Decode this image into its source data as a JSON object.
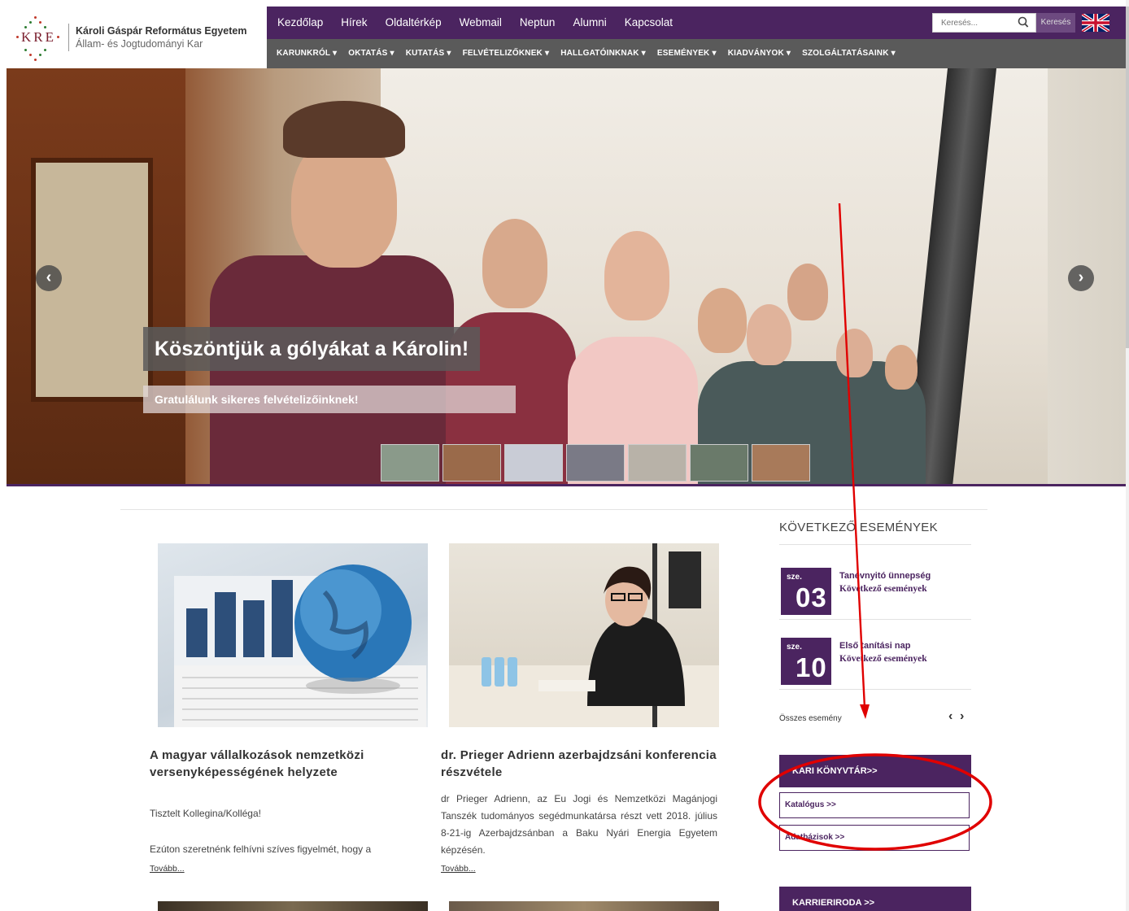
{
  "header": {
    "logo_mark": "KRE",
    "logo_line1": "Károli Gáspár Református Egyetem",
    "logo_line2": "Állam- és Jogtudományi Kar"
  },
  "top_links": [
    "Kezdőlap",
    "Hírek",
    "Oldaltérkép",
    "Webmail",
    "Neptun",
    "Alumni",
    "Kapcsolat"
  ],
  "search": {
    "placeholder": "Keresés...",
    "button_label": "Keresés"
  },
  "main_nav": [
    "KARUNKRÓL ▾",
    "OKTATÁS ▾",
    "KUTATÁS ▾",
    "FELVÉTELIZŐKNEK ▾",
    "HALLGATÓINKNAK ▾",
    "ESEMÉNYEK ▾",
    "KIADVÁNYOK ▾",
    "SZOLGÁLTATÁSAINK ▾"
  ],
  "hero": {
    "caption": "Köszöntjük a gólyákat a Károlin!",
    "subcaption": "Gratulálunk sikeres felvételizőinknek!",
    "prev_icon": "chevron-left-icon",
    "next_icon": "chevron-right-icon",
    "prev_glyph": "‹",
    "next_glyph": "›",
    "thumbnail_colors": [
      "#8a9a8a",
      "#9a6a4a",
      "#c9ccd6",
      "#7a7a86",
      "#b8b2a8",
      "#6a7a6a",
      "#a87a5a"
    ]
  },
  "articles": [
    {
      "title": "A magyar vállalkozások nemzetközi versenyképességének helyzete",
      "para1": "Tisztelt Kollegina/Kolléga!",
      "para2": "Ezúton szeretnénk felhívni szíves figyelmét, hogy a",
      "more": "Tovább..."
    },
    {
      "title": "dr. Prieger Adrienn azerbajdzsáni konferencia részvétele",
      "para1": "dr Prieger Adrienn, az Eu Jogi és Nemzetközi Magánjogi Tanszék tudományos segédmunkatársa részt vett 2018. július 8-21-ig Azerbajdzsánban a Baku Nyári Energia Egyetem képzésén.",
      "more": "Tovább..."
    }
  ],
  "sidebar": {
    "events_title": "KÖVETKEZŐ ESEMÉNYEK",
    "events": [
      {
        "month": "sze.",
        "day": "03",
        "title": "Tanévnyitó ünnepség",
        "subtitle": "Következő események"
      },
      {
        "month": "sze.",
        "day": "10",
        "title": "Első tanítási nap",
        "subtitle": "Következő események"
      }
    ],
    "all_events": "Összes esemény",
    "prev_glyph": "‹",
    "next_glyph": "›",
    "library_button": "KARI KÖNYVTÁR>>",
    "catalog_link": "Katalógus >>",
    "databases_link": "Adatbázisok >>",
    "career_button": "KARRIERIRODA >>"
  },
  "colors": {
    "brand_purple": "#4b2460",
    "nav_gray": "#5a5a5a",
    "annotation_red": "#e00000"
  }
}
